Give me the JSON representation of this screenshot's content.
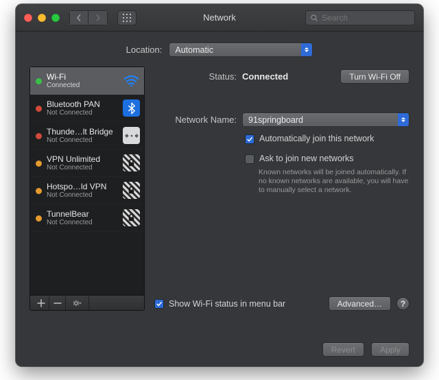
{
  "window": {
    "title": "Network",
    "search_placeholder": "Search"
  },
  "location": {
    "label": "Location:",
    "value": "Automatic"
  },
  "sidebar": {
    "items": [
      {
        "name": "Wi-Fi",
        "sub": "Connected",
        "status": "green",
        "icon": "wifi",
        "active": true
      },
      {
        "name": "Bluetooth PAN",
        "sub": "Not Connected",
        "status": "red",
        "icon": "bluetooth"
      },
      {
        "name": "Thunde…lt Bridge",
        "sub": "Not Connected",
        "status": "red",
        "icon": "thunderbolt"
      },
      {
        "name": "VPN Unlimited",
        "sub": "Not Connected",
        "status": "orange",
        "icon": "lock"
      },
      {
        "name": "Hotspo…ld VPN",
        "sub": "Not Connected",
        "status": "orange",
        "icon": "lock"
      },
      {
        "name": "TunnelBear",
        "sub": "Not Connected",
        "status": "orange",
        "icon": "lock"
      }
    ]
  },
  "details": {
    "status_label": "Status:",
    "status_value": "Connected",
    "wifi_off_btn": "Turn Wi-Fi Off",
    "network_name_label": "Network Name:",
    "network_name_value": "91springboard",
    "auto_join": "Automatically join this network",
    "ask_join": "Ask to join new networks",
    "ask_hint": "Known networks will be joined automatically. If no known networks are available, you will have to manually select a network.",
    "show_menubar": "Show Wi-Fi status in menu bar",
    "advanced_btn": "Advanced…"
  },
  "footer": {
    "revert": "Revert",
    "apply": "Apply"
  }
}
